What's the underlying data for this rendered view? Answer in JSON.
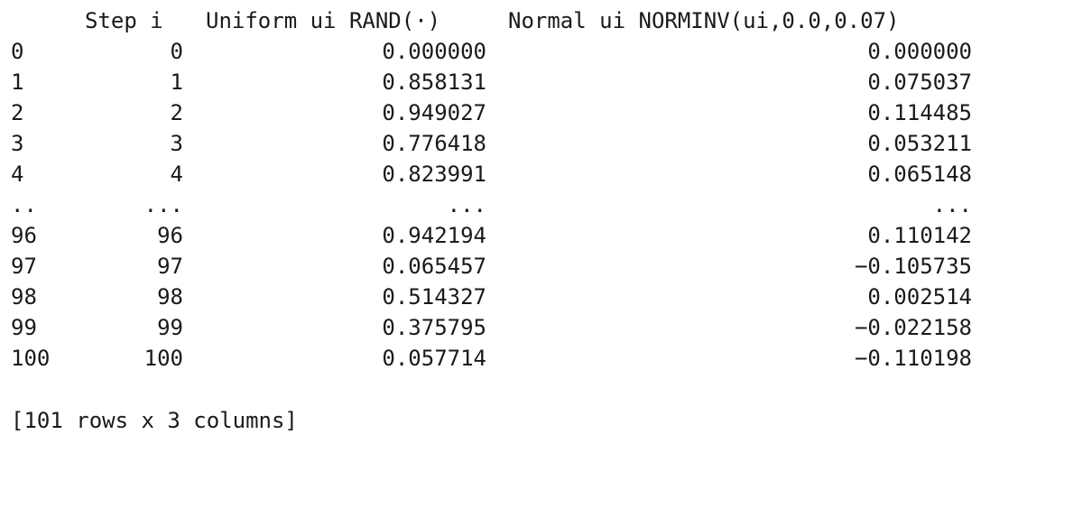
{
  "table": {
    "columns": [
      "Step i",
      "Uniform ui RAND(·)",
      "Normal ui NORMINV(ui,0.0,0.07)"
    ],
    "rows": [
      [
        "0",
        "0",
        "0.000000",
        "0.000000"
      ],
      [
        "1",
        "1",
        "0.858131",
        "0.075037"
      ],
      [
        "2",
        "2",
        "0.949027",
        "0.114485"
      ],
      [
        "3",
        "3",
        "0.776418",
        "0.053211"
      ],
      [
        "4",
        "4",
        "0.823991",
        "0.065148"
      ],
      [
        "..",
        "...",
        "...",
        "..."
      ],
      [
        "96",
        "96",
        "0.942194",
        "0.110142"
      ],
      [
        "97",
        "97",
        "0.065457",
        "−0.105735"
      ],
      [
        "98",
        "98",
        "0.514327",
        "0.002514"
      ],
      [
        "99",
        "99",
        "0.375795",
        "−0.022158"
      ],
      [
        "100",
        "100",
        "0.057714",
        "−0.110198"
      ]
    ]
  },
  "summary": "[101 rows x 3 columns]"
}
